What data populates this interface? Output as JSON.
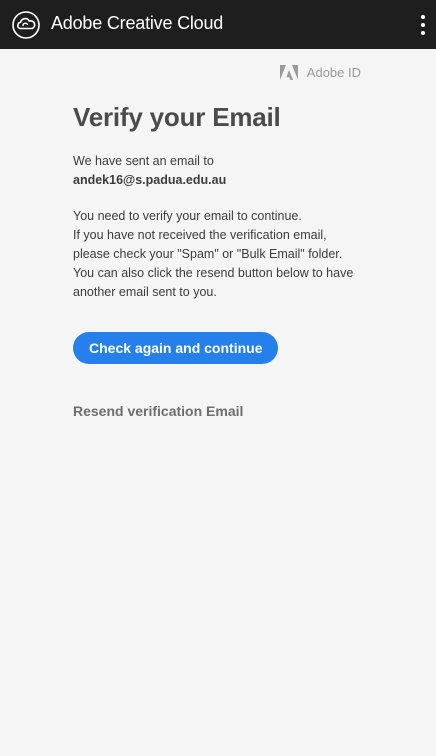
{
  "titlebar": {
    "app_title": "Adobe Creative Cloud",
    "logo_icon": "creative-cloud-logo-icon",
    "menu_icon": "more-vertical-icon"
  },
  "brand": {
    "adobe_id_label": "Adobe ID",
    "adobe_icon": "adobe-logo-icon"
  },
  "main": {
    "heading": "Verify your Email",
    "sent_line": "We have sent an email to",
    "email": "andek16@s.padua.edu.au",
    "instructions": [
      "You need to verify your email to continue.",
      "If you have not received the verification email,",
      "please check your \"Spam\" or \"Bulk Email\" folder.",
      "You can also click the resend button below to have",
      "another email sent to you."
    ],
    "continue_button": "Check again and continue",
    "resend_link": "Resend verification Email"
  },
  "colors": {
    "titlebar_bg": "#1e1e1e",
    "page_bg": "#f5f5f5",
    "accent": "#2680eb"
  }
}
